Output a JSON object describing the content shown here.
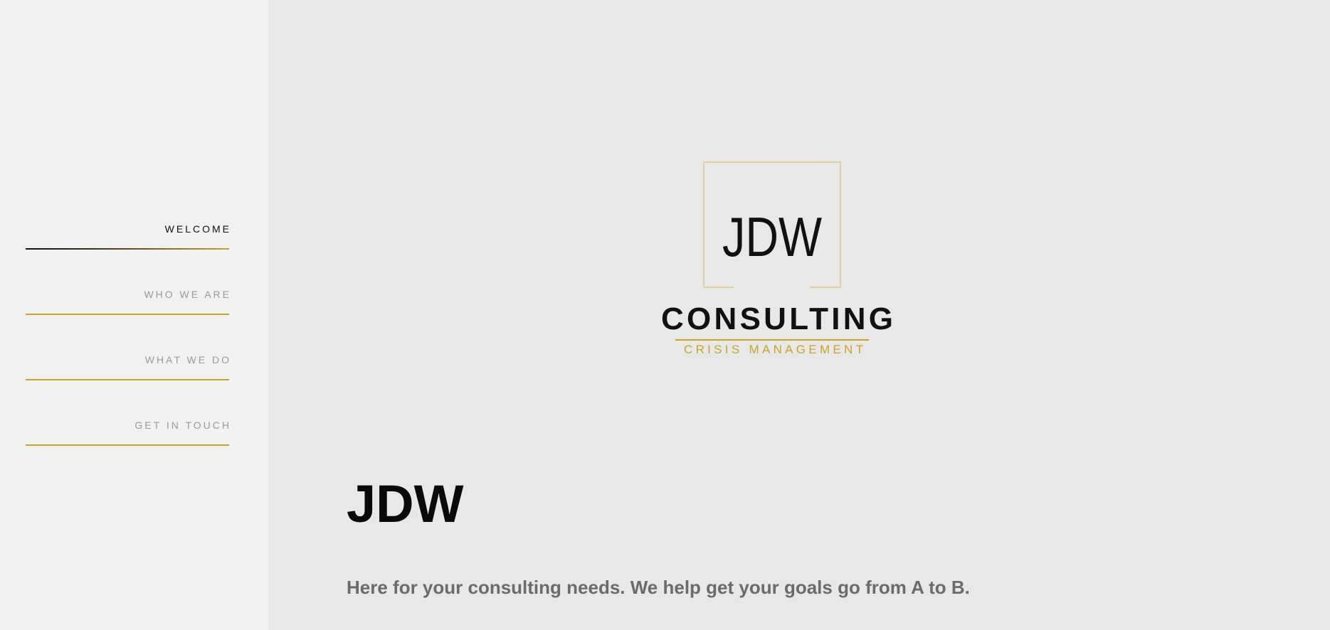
{
  "nav": {
    "items": [
      {
        "label": "WELCOME",
        "active": true
      },
      {
        "label": "WHO WE ARE",
        "active": false
      },
      {
        "label": "WHAT WE DO",
        "active": false
      },
      {
        "label": "GET IN TOUCH",
        "active": false
      }
    ]
  },
  "logo": {
    "monogram": "JDW",
    "company": "CONSULTING",
    "subtitle": "CRISIS MANAGEMENT"
  },
  "hero": {
    "title": "JDW",
    "tagline": "Here for your consulting needs. We help get your goals go from A to B."
  },
  "colors": {
    "accent_gold": "#c9a428",
    "frame_gold": "#e3cfa0",
    "sidebar_bg": "#f1f1f1",
    "main_bg": "#e8e8e8",
    "text_dark": "#0a0a0a",
    "text_muted": "#6b6b6b"
  }
}
